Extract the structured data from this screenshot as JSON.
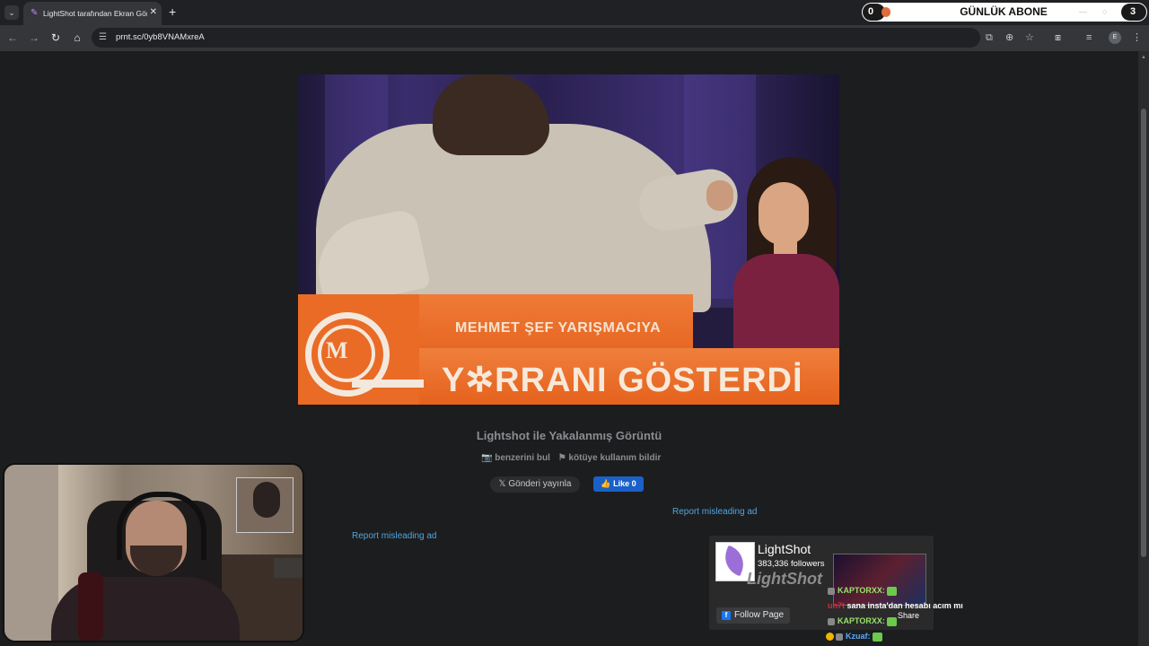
{
  "browser": {
    "tab_title": "LightShot tarafından Ekran Görüntüsü",
    "new_tab_symbol": "+",
    "url": "prnt.sc/0yb8VNAMxreA",
    "profile_initial": "E"
  },
  "stream_overlay": {
    "ticker_left_value": "0",
    "ticker_label": "GÜNLÜK ABONE",
    "ticker_right_value": "3"
  },
  "screenshot_image": {
    "caption_top": "MEHMET ŞEF YARIŞMACIYA",
    "caption_bottom": "Y✲RRANI GÖSTERDİ",
    "logo_letter": "M"
  },
  "page": {
    "title": "Lightshot ile Yakalanmış Görüntü",
    "find_similar": "benzerini bul",
    "report_abuse": "kötüye kullanım bildir",
    "share_label": "Gönderi yayınla",
    "like_label": "Like 0",
    "report_ad_1": "Report misleading ad",
    "report_ad_2": "Report misleading ad"
  },
  "fb_widget": {
    "page_name": "LightShot",
    "followers": "383,336 followers",
    "brand_text": "LightShot",
    "follow_label": "Follow Page",
    "share_label": "Share"
  },
  "chat": [
    {
      "user": "KAPTORXX:",
      "message": ""
    },
    {
      "user": "un7t",
      "message": "sana insta'dan hesabı acım mı"
    },
    {
      "user": "KAPTORXX:",
      "message": ""
    },
    {
      "user": "Kzuaf:",
      "message": ""
    }
  ]
}
